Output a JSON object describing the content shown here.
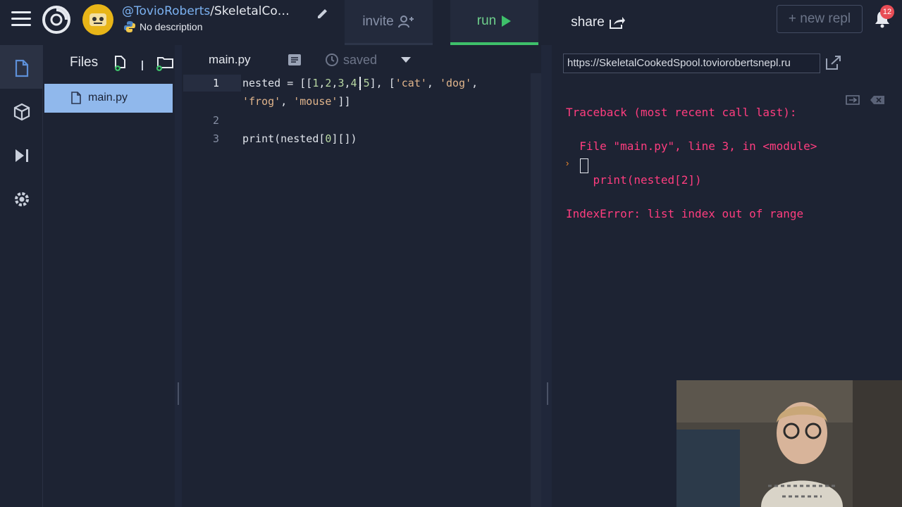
{
  "header": {
    "user": "@TovioRoberts",
    "repl_name": "/SkeletalCo…",
    "description": "No description",
    "invite_label": "invite",
    "run_label": "run",
    "share_label": "share",
    "new_repl_label": "+ new repl",
    "notifications_count": "12"
  },
  "rail": {
    "items": [
      "file-icon",
      "package-icon",
      "debugger-icon",
      "gear-icon"
    ]
  },
  "files": {
    "title": "Files",
    "items": [
      {
        "label": "main.py",
        "selected": true
      }
    ]
  },
  "editor": {
    "tab_label": "main.py",
    "status": "saved",
    "line_numbers": [
      "1",
      "2",
      "3"
    ]
  },
  "output": {
    "url": "https://SkeletalCookedSpool.toviorobertsnepl.ru",
    "console_lines": [
      "Traceback (most recent call last):",
      "  File \"main.py\", line 3, in <module>",
      "    print(nested[2])",
      "IndexError: list index out of range"
    ],
    "prompt": "›"
  },
  "colors": {
    "accent_run": "#3ec06a",
    "error": "#ff3d7f",
    "selected_file": "#90b8ec"
  }
}
